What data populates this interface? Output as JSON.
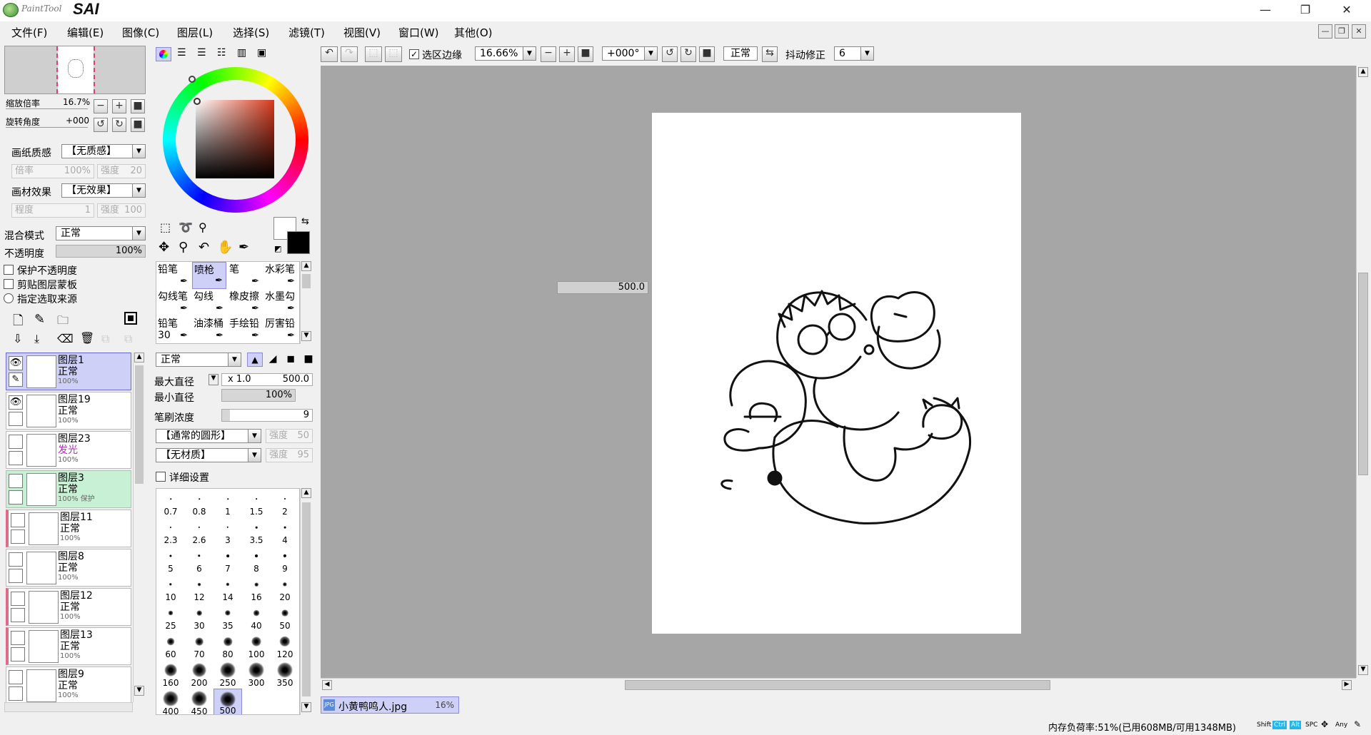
{
  "app": {
    "brand": "PaintTool",
    "name": "SAI"
  },
  "window_controls": {
    "minimize": "—",
    "restore": "❐",
    "close": "✕"
  },
  "menu": [
    "文件(F)",
    "编辑(E)",
    "图像(C)",
    "图层(L)",
    "选择(S)",
    "滤镜(T)",
    "视图(V)",
    "窗口(W)",
    "其他(O)"
  ],
  "navigator": {
    "zoom_label": "缩放倍率",
    "zoom_value": "16.7%",
    "rotate_label": "旋转角度",
    "rotate_value": "+000"
  },
  "paper_texture": {
    "label": "画纸质感",
    "value": "【无质感】",
    "scale_label": "倍率",
    "scale_value": "100%",
    "strength_label": "强度",
    "strength_value": "20"
  },
  "material_effect": {
    "label": "画材效果",
    "value": "【无效果】",
    "degree_label": "程度",
    "degree_value": "1",
    "strength_label": "强度",
    "strength_value": "100"
  },
  "blend": {
    "label": "混合模式",
    "value": "正常"
  },
  "opacity": {
    "label": "不透明度",
    "value": "100%",
    "fraction": 1.0
  },
  "options": {
    "protect_opacity": "保护不透明度",
    "clip_mask": "剪贴图层蒙板",
    "selection_source": "指定选取来源"
  },
  "layers": [
    {
      "name": "图层1",
      "mode": "正常",
      "opacity": "100%",
      "selected": true,
      "visible": true
    },
    {
      "name": "图层19",
      "mode": "正常",
      "opacity": "100%",
      "visible": true
    },
    {
      "name": "图层23",
      "mode": "发光",
      "opacity": "100%",
      "glow": true
    },
    {
      "name": "图层3",
      "mode": "正常",
      "opacity": "100% 保护",
      "green": true
    },
    {
      "name": "图层11",
      "mode": "正常",
      "opacity": "100%",
      "clip": true
    },
    {
      "name": "图层8",
      "mode": "正常",
      "opacity": "100%"
    },
    {
      "name": "图层12",
      "mode": "正常",
      "opacity": "100%",
      "clip": true
    },
    {
      "name": "图层13",
      "mode": "正常",
      "opacity": "100%",
      "clip": true
    },
    {
      "name": "图层9",
      "mode": "正常",
      "opacity": "100%"
    }
  ],
  "tools": [
    {
      "label": "铅笔"
    },
    {
      "label": "喷枪",
      "selected": true
    },
    {
      "label": "笔"
    },
    {
      "label": "水彩笔"
    },
    {
      "label": "勾线笔"
    },
    {
      "label": "勾线"
    },
    {
      "label": "橡皮擦"
    },
    {
      "label": "水墨勾"
    },
    {
      "label": "铅笔30"
    },
    {
      "label": "油漆桶"
    },
    {
      "label": "手绘铅"
    },
    {
      "label": "厉害铅"
    }
  ],
  "tool_settings": {
    "mode": "正常",
    "max_diameter_label": "最大直径",
    "max_diameter_mult": "x 1.0",
    "max_diameter_value": "500.0",
    "min_diameter_label": "最小直径",
    "min_diameter_value": "100%",
    "density_label": "笔刷浓度",
    "density_value": "9",
    "shape": "【通常的圆形】",
    "shape_strength_label": "强度",
    "shape_strength_value": "50",
    "texture": "【无材质】",
    "texture_strength_label": "强度",
    "texture_strength_value": "95",
    "detail_settings": "详细设置"
  },
  "brush_sizes": [
    "0.7",
    "0.8",
    "1",
    "1.5",
    "2",
    "2.3",
    "2.6",
    "3",
    "3.5",
    "4",
    "5",
    "6",
    "7",
    "8",
    "9",
    "10",
    "12",
    "14",
    "16",
    "20",
    "25",
    "30",
    "35",
    "40",
    "50",
    "60",
    "70",
    "80",
    "100",
    "120",
    "160",
    "200",
    "250",
    "300",
    "350",
    "400",
    "450",
    "500"
  ],
  "selected_brush_size": "500",
  "toolbar": {
    "selection_edge": "选区边缘",
    "zoom": "16.66%",
    "angle": "+000°",
    "mode": "正常",
    "stabilizer_label": "抖动修正",
    "stabilizer_value": "6"
  },
  "canvas": {
    "size_popup": "500.0"
  },
  "document_tab": {
    "name": "小黄鸭鸣人.jpg",
    "zoom": "16%"
  },
  "status": {
    "memory": "内存负荷率:51%(已用608MB/可用1348MB)",
    "keys": [
      "Shift",
      "Ctrl",
      "Alt",
      "SPC",
      "Any"
    ]
  },
  "colors": {
    "accent_selected": "#cfd0f7",
    "layer_green": "#c8f0d4",
    "canvas_bg": "#a6a6a6"
  }
}
